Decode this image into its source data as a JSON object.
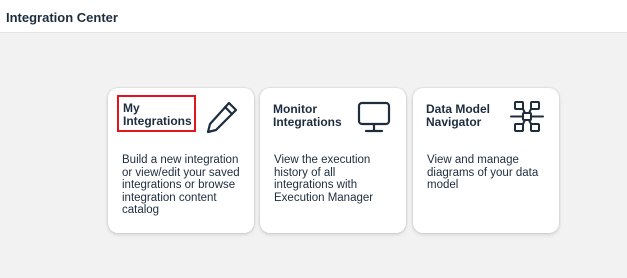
{
  "header": {
    "title": "Integration Center"
  },
  "tiles": [
    {
      "title": "My\nIntegrations",
      "description": "Build a new integration or view/edit your saved integrations or browse integration content catalog",
      "icon": "pencil-icon"
    },
    {
      "title": "Monitor\nIntegrations",
      "description": "View the execution history of all integrations with Execution Manager",
      "icon": "monitor-icon"
    },
    {
      "title": "Data Model\nNavigator",
      "description": "View and manage diagrams of your data model",
      "icon": "network-icon"
    }
  ],
  "colors": {
    "highlight_border": "#e0161e",
    "text": "#1d2d3e",
    "background": "#f2f2f2"
  }
}
